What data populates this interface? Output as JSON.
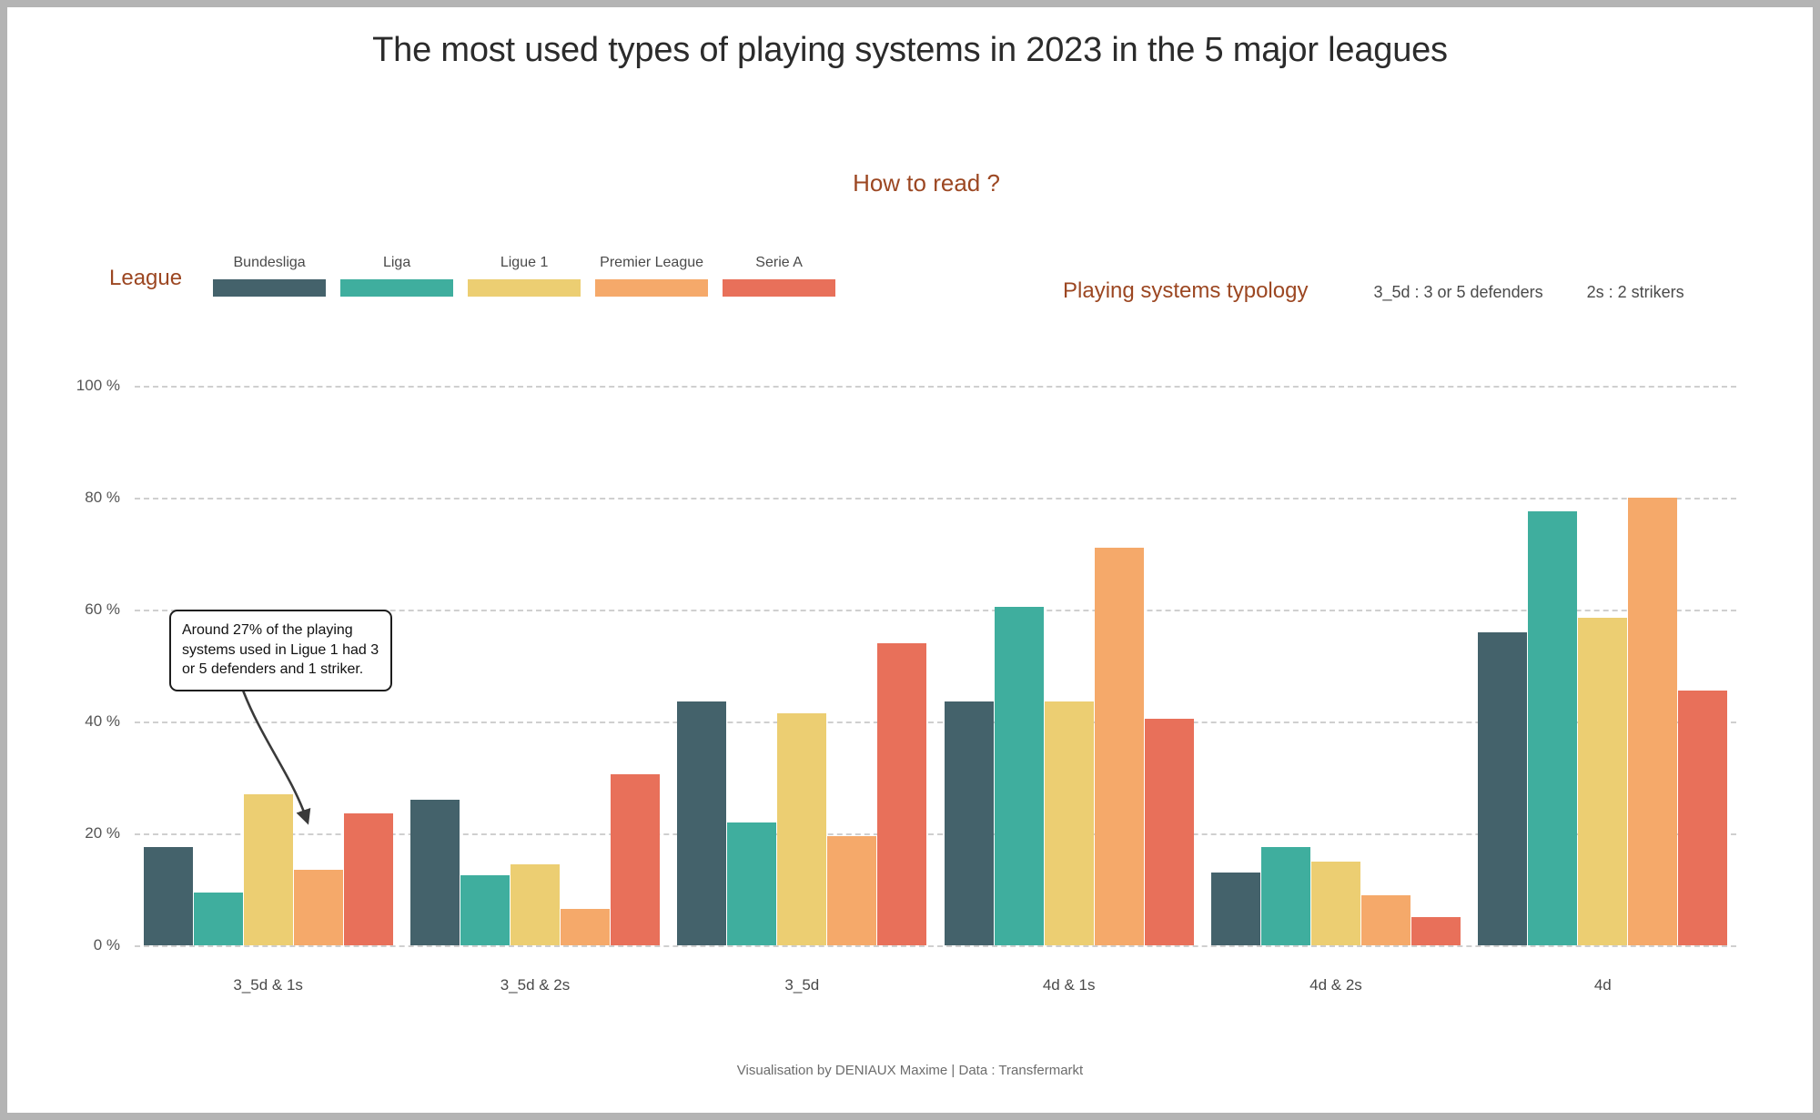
{
  "header": {
    "title": "The most used types of playing systems in 2023 in the 5 major leagues",
    "how_to_read": "How to read ?"
  },
  "legend": {
    "league_title": "League",
    "items": [
      {
        "label": "Bundesliga",
        "color": "#44626b"
      },
      {
        "label": "Liga",
        "color": "#3fae9e"
      },
      {
        "label": "Ligue 1",
        "color": "#ecce72"
      },
      {
        "label": "Premier League",
        "color": "#f5a96a"
      },
      {
        "label": "Serie A",
        "color": "#e8705a"
      }
    ],
    "typology_title": "Playing systems typology",
    "typology_entries": [
      "3_5d  :  3 or 5 defenders",
      "2s  :  2 strikers"
    ]
  },
  "annotation": {
    "text": "Around 27% of the playing systems used in Ligue 1 had 3 or 5 defenders and 1 striker.",
    "target_series": "Ligue 1",
    "target_category": "3_5d & 1s",
    "target_value": 27
  },
  "footer": {
    "credit": "Visualisation by DENIAUX Maxime | Data : Transfermarkt"
  },
  "chart_data": {
    "type": "bar",
    "title": "The most used types of playing systems in 2023 in the 5 major leagues",
    "xlabel": "",
    "ylabel": "",
    "ylim": [
      0,
      100
    ],
    "ytick_labels": [
      "0 %",
      "20 %",
      "40 %",
      "60 %",
      "80 %",
      "100 %"
    ],
    "yticks": [
      0,
      20,
      40,
      60,
      80,
      100
    ],
    "grid": true,
    "legend_position": "top-left",
    "categories": [
      "3_5d & 1s",
      "3_5d & 2s",
      "3_5d",
      "4d & 1s",
      "4d & 2s",
      "4d"
    ],
    "series": [
      {
        "name": "Bundesliga",
        "color": "#44626b",
        "values": [
          17.5,
          26.0,
          43.5,
          43.5,
          13.0,
          56.0
        ]
      },
      {
        "name": "Liga",
        "color": "#3fae9e",
        "values": [
          9.5,
          12.5,
          22.0,
          60.5,
          17.5,
          77.5
        ]
      },
      {
        "name": "Ligue 1",
        "color": "#ecce72",
        "values": [
          27.0,
          14.5,
          41.5,
          43.5,
          15.0,
          58.5
        ]
      },
      {
        "name": "Premier League",
        "color": "#f5a96a",
        "values": [
          13.5,
          6.5,
          19.5,
          71.0,
          9.0,
          80.0
        ]
      },
      {
        "name": "Serie A",
        "color": "#e8705a",
        "values": [
          23.5,
          30.5,
          54.0,
          40.5,
          5.0,
          45.5
        ]
      }
    ]
  }
}
